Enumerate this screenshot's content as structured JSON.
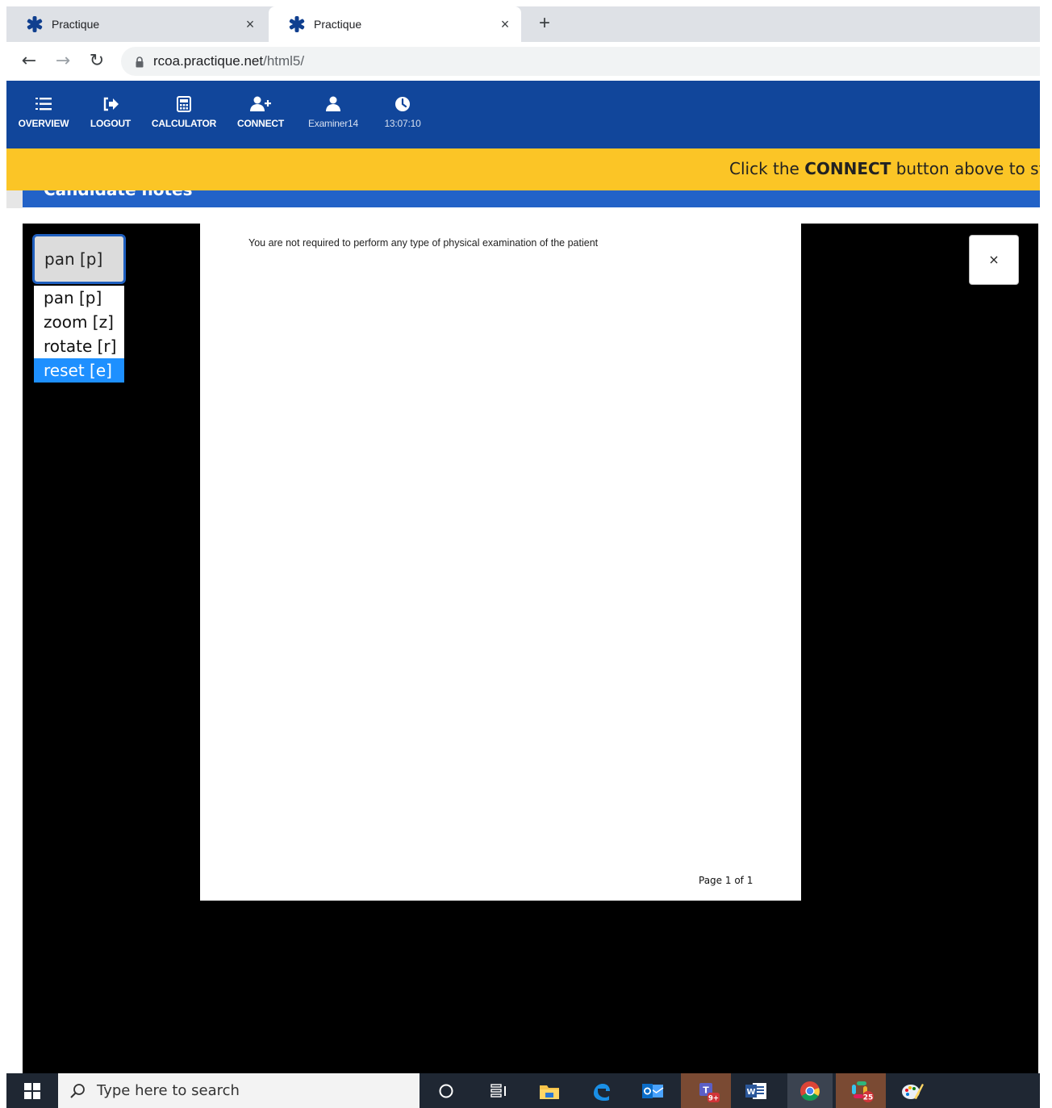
{
  "browser": {
    "tabs": [
      {
        "title": "Practique",
        "active": false
      },
      {
        "title": "Practique",
        "active": true
      }
    ],
    "new_tab": "+",
    "close_tab": "×",
    "url_domain": "rcoa.practique.net",
    "url_path": "/html5/"
  },
  "toolbar": {
    "overview": "OVERVIEW",
    "logout": "LOGOUT",
    "calculator": "CALCULATOR",
    "connect": "CONNECT",
    "user": "Examiner14",
    "time": "13:07:10"
  },
  "banner": {
    "prefix": "Click the ",
    "bold": "CONNECT",
    "suffix": " button above to sta"
  },
  "section_title": "Candidate notes",
  "viewer": {
    "mode_selected": "pan [p]",
    "mode_options": [
      "pan [p]",
      "zoom [z]",
      "rotate [r]",
      "reset [e]"
    ],
    "highlighted_option": "reset [e]",
    "close": "×",
    "page_text_cut": "· · · · · · · · · · · · · · ·",
    "page_text": "You are not required to perform any type of physical examination of the patient",
    "page_number": "Page 1 of 1"
  },
  "taskbar": {
    "search_placeholder": "Type here to search",
    "teams_badge": "9+",
    "slack_badge": "25"
  },
  "colors": {
    "app_blue": "#11469b",
    "banner_yellow": "#fbc526",
    "option_highlight": "#1e90ff"
  }
}
